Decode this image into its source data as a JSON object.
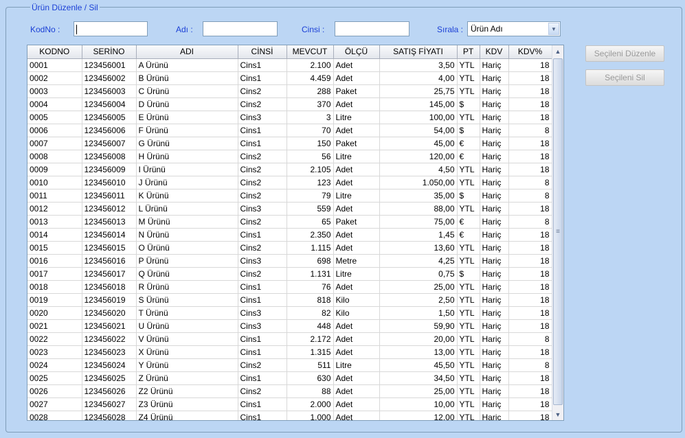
{
  "group_title": "Ürün Düzenle / Sil",
  "filters": {
    "kodno_label": "KodNo :",
    "kodno_value": "",
    "adi_label": "Adı :",
    "adi_value": "",
    "cinsi_label": "Cinsi :",
    "cinsi_value": "",
    "sirala_label": "Sırala :",
    "sirala_value": "Ürün Adı"
  },
  "buttons": {
    "edit_label": "Seçileni Düzenle",
    "delete_label": "Seçileni Sil"
  },
  "table": {
    "columns": [
      "KODNO",
      "SERİNO",
      "ADI",
      "CİNSİ",
      "MEVCUT",
      "ÖLÇÜ",
      "SATIŞ FİYATI",
      "PT",
      "KDV",
      "KDV%"
    ],
    "rows": [
      [
        "0001",
        "123456001",
        "A Ürünü",
        "Cins1",
        "2.100",
        "Adet",
        "3,50",
        "YTL",
        "Hariç",
        "18"
      ],
      [
        "0002",
        "123456002",
        "B Ürünü",
        "Cins1",
        "4.459",
        "Adet",
        "4,00",
        "YTL",
        "Hariç",
        "18"
      ],
      [
        "0003",
        "123456003",
        "C Ürünü",
        "Cins2",
        "288",
        "Paket",
        "25,75",
        "YTL",
        "Hariç",
        "18"
      ],
      [
        "0004",
        "123456004",
        "D Ürünü",
        "Cins2",
        "370",
        "Adet",
        "145,00",
        "$",
        "Hariç",
        "18"
      ],
      [
        "0005",
        "123456005",
        "E Ürünü",
        "Cins3",
        "3",
        "Litre",
        "100,00",
        "YTL",
        "Hariç",
        "18"
      ],
      [
        "0006",
        "123456006",
        "F Ürünü",
        "Cins1",
        "70",
        "Adet",
        "54,00",
        "$",
        "Hariç",
        "8"
      ],
      [
        "0007",
        "123456007",
        "G Ürünü",
        "Cins1",
        "150",
        "Paket",
        "45,00",
        "€",
        "Hariç",
        "18"
      ],
      [
        "0008",
        "123456008",
        "H Ürünü",
        "Cins2",
        "56",
        "Litre",
        "120,00",
        "€",
        "Hariç",
        "18"
      ],
      [
        "0009",
        "123456009",
        "I Ürünü",
        "Cins2",
        "2.105",
        "Adet",
        "4,50",
        "YTL",
        "Hariç",
        "18"
      ],
      [
        "0010",
        "123456010",
        "J Ürünü",
        "Cins2",
        "123",
        "Adet",
        "1.050,00",
        "YTL",
        "Hariç",
        "8"
      ],
      [
        "0011",
        "123456011",
        "K Ürünü",
        "Cins2",
        "79",
        "Litre",
        "35,00",
        "$",
        "Hariç",
        "8"
      ],
      [
        "0012",
        "123456012",
        "L Ürünü",
        "Cins3",
        "559",
        "Adet",
        "88,00",
        "YTL",
        "Hariç",
        "18"
      ],
      [
        "0013",
        "123456013",
        "M Ürünü",
        "Cins2",
        "65",
        "Paket",
        "75,00",
        "€",
        "Hariç",
        "8"
      ],
      [
        "0014",
        "123456014",
        "N Ürünü",
        "Cins1",
        "2.350",
        "Adet",
        "1,45",
        "€",
        "Hariç",
        "18"
      ],
      [
        "0015",
        "123456015",
        "O Ürünü",
        "Cins2",
        "1.115",
        "Adet",
        "13,60",
        "YTL",
        "Hariç",
        "18"
      ],
      [
        "0016",
        "123456016",
        "P Ürünü",
        "Cins3",
        "698",
        "Metre",
        "4,25",
        "YTL",
        "Hariç",
        "18"
      ],
      [
        "0017",
        "123456017",
        "Q Ürünü",
        "Cins2",
        "1.131",
        "Litre",
        "0,75",
        "$",
        "Hariç",
        "18"
      ],
      [
        "0018",
        "123456018",
        "R Ürünü",
        "Cins1",
        "76",
        "Adet",
        "25,00",
        "YTL",
        "Hariç",
        "18"
      ],
      [
        "0019",
        "123456019",
        "S Ürünü",
        "Cins1",
        "818",
        "Kilo",
        "2,50",
        "YTL",
        "Hariç",
        "18"
      ],
      [
        "0020",
        "123456020",
        "T Ürünü",
        "Cins3",
        "82",
        "Kilo",
        "1,50",
        "YTL",
        "Hariç",
        "18"
      ],
      [
        "0021",
        "123456021",
        "U Ürünü",
        "Cins3",
        "448",
        "Adet",
        "59,90",
        "YTL",
        "Hariç",
        "18"
      ],
      [
        "0022",
        "123456022",
        "V Ürünü",
        "Cins1",
        "2.172",
        "Adet",
        "20,00",
        "YTL",
        "Hariç",
        "8"
      ],
      [
        "0023",
        "123456023",
        "X Ürünü",
        "Cins1",
        "1.315",
        "Adet",
        "13,00",
        "YTL",
        "Hariç",
        "18"
      ],
      [
        "0024",
        "123456024",
        "Y Ürünü",
        "Cins2",
        "511",
        "Litre",
        "45,50",
        "YTL",
        "Hariç",
        "8"
      ],
      [
        "0025",
        "123456025",
        "Z Ürünü",
        "Cins1",
        "630",
        "Adet",
        "34,50",
        "YTL",
        "Hariç",
        "18"
      ],
      [
        "0026",
        "123456026",
        "Z2 Ürünü",
        "Cins2",
        "88",
        "Adet",
        "25,00",
        "YTL",
        "Hariç",
        "18"
      ],
      [
        "0027",
        "123456027",
        "Z3 Ürünü",
        "Cins1",
        "2.000",
        "Adet",
        "10,00",
        "YTL",
        "Hariç",
        "18"
      ],
      [
        "0028",
        "123456028",
        "Z4 Ürünü",
        "Cins1",
        "1.000",
        "Adet",
        "12,00",
        "YTL",
        "Hariç",
        "18"
      ]
    ]
  },
  "icons": {
    "combo_arrow": "chevron-down-icon",
    "scroll_up": "scroll-up-icon",
    "scroll_down": "scroll-down-icon",
    "scroll_grip": "grip-icon"
  }
}
